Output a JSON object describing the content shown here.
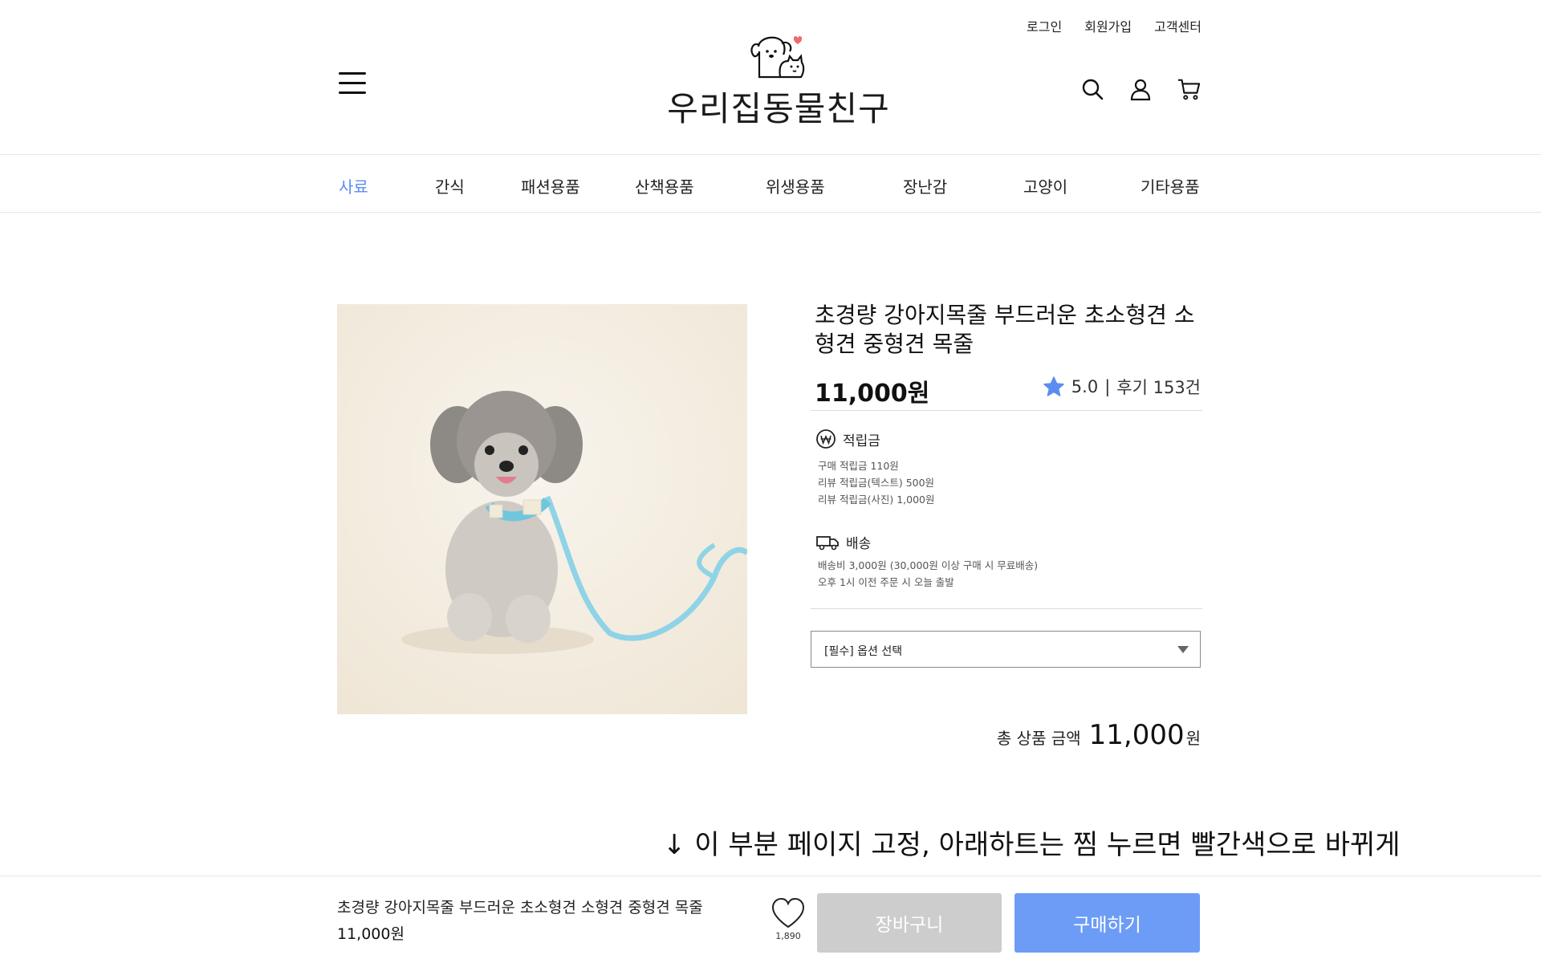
{
  "header": {
    "util_links": [
      "로그인",
      "회원가입",
      "고객센터"
    ],
    "logo_text": "우리집동물친구",
    "icons": [
      "menu-icon",
      "search-icon",
      "user-icon",
      "cart-icon"
    ]
  },
  "nav": {
    "items": [
      "사료",
      "간식",
      "패션용품",
      "산책용품",
      "위생용품",
      "장난감",
      "고양이",
      "기타용품"
    ],
    "active": "사료"
  },
  "product": {
    "title": "초경량 강아지목줄 부드러운 초소형견 소형견 중형견 목줄",
    "price": "11,000원",
    "rating": "5.0",
    "separator": "|",
    "reviews": "후기 153건",
    "points": {
      "heading": "적립금",
      "lines": [
        "구매 적립금 110원",
        "리뷰 적립금(텍스트) 500원",
        "리뷰 적립금(사진) 1,000원"
      ]
    },
    "shipping": {
      "heading": "배송",
      "lines": [
        "배송비 3,000원 (30,000원 이상 구매 시 무료배송)",
        "오후 1시 이전 주문 시 오늘 출발"
      ]
    },
    "option_placeholder": "[필수] 옵션 선택",
    "total_label": "총 상품 금액",
    "total_value": "11,000",
    "total_unit": "원"
  },
  "note": "↓ 이 부분 페이지 고정, 아래하트는 찜 누르면 빨간색으로 바뀌게",
  "bottom_bar": {
    "title": "초경량 강아지목줄 부드러운 초소형견 소형견 중형견 목줄",
    "price": "11,000원",
    "wish_count": "1,890",
    "cart_label": "장바구니",
    "buy_label": "구매하기"
  },
  "colors": {
    "accent": "#5b8def",
    "buy_button": "#6c9cf6",
    "cart_button": "#cdcdcd",
    "star": "#5b8def"
  }
}
